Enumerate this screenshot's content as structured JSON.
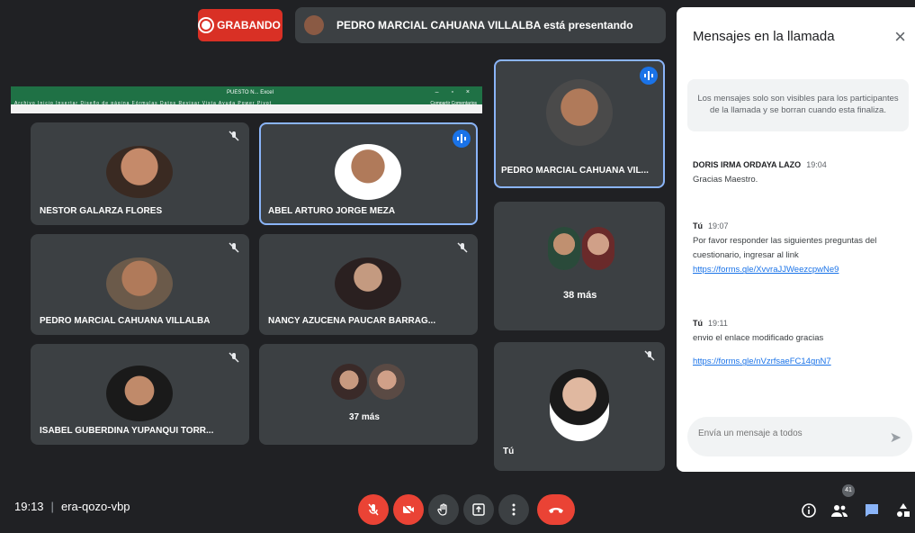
{
  "banner": {
    "recording_label": "GRABANDO",
    "presenting_text": "PEDRO MARCIAL CAHUANA VILLALBA está presentando"
  },
  "excel": {
    "title": "PUESTO N...   Excel",
    "menu": "Archivo  Inicio  Insertar  Diseño de página  Fórmulas  Datos  Revisar  Vista  Ayuda  Power Pivot",
    "right": "Compartir   Comentarios"
  },
  "tiles": [
    {
      "name": "NÉSTOR GALARZA FLORES"
    },
    {
      "name": "ABEL ARTURO JORGE MEZA"
    },
    {
      "name": "PEDRO MARCIAL CAHUANA VILLALBA"
    },
    {
      "name": "NANCY AZUCENA PAUCAR BARRAG..."
    },
    {
      "name": "ISABEL GUBERDINA YUPANQUI TORR..."
    },
    {
      "more": "37 más"
    }
  ],
  "side_tiles": {
    "presenter_name": "PEDRO MARCIAL CAHUANA VIL...",
    "more": "38 más",
    "self_name": "Tú"
  },
  "chat": {
    "title": "Mensajes en la llamada",
    "close": "×",
    "notice": "Los mensajes solo son visibles para los participantes de la llamada y se borran cuando esta finaliza.",
    "messages": [
      {
        "sender": "DORIS IRMA ORDAYA LAZO",
        "time": "19:04",
        "text": "Gracias Maestro.",
        "link": ""
      },
      {
        "sender": "Tú",
        "time": "19:07",
        "text": "Por favor responder las siguientes preguntas del cuestionario, ingresar al link",
        "link": "https://forms.gle/XvvraJJWeezcpwNe9"
      },
      {
        "sender": "Tú",
        "time": "19:11",
        "text": "envio el enlace modificado gracias",
        "link": "https://forms.gle/nVzrfsaeFC14gnN7"
      }
    ],
    "input_placeholder": "Envía un mensaje a todos"
  },
  "bottom": {
    "time": "19:13",
    "meeting_code": "era-qozo-vbp",
    "participant_count": "41"
  },
  "colors": {
    "background": "#202124",
    "tile": "#3c4043",
    "accent": "#8ab4f8",
    "red": "#ea4335",
    "excel_green": "#1f7145"
  }
}
